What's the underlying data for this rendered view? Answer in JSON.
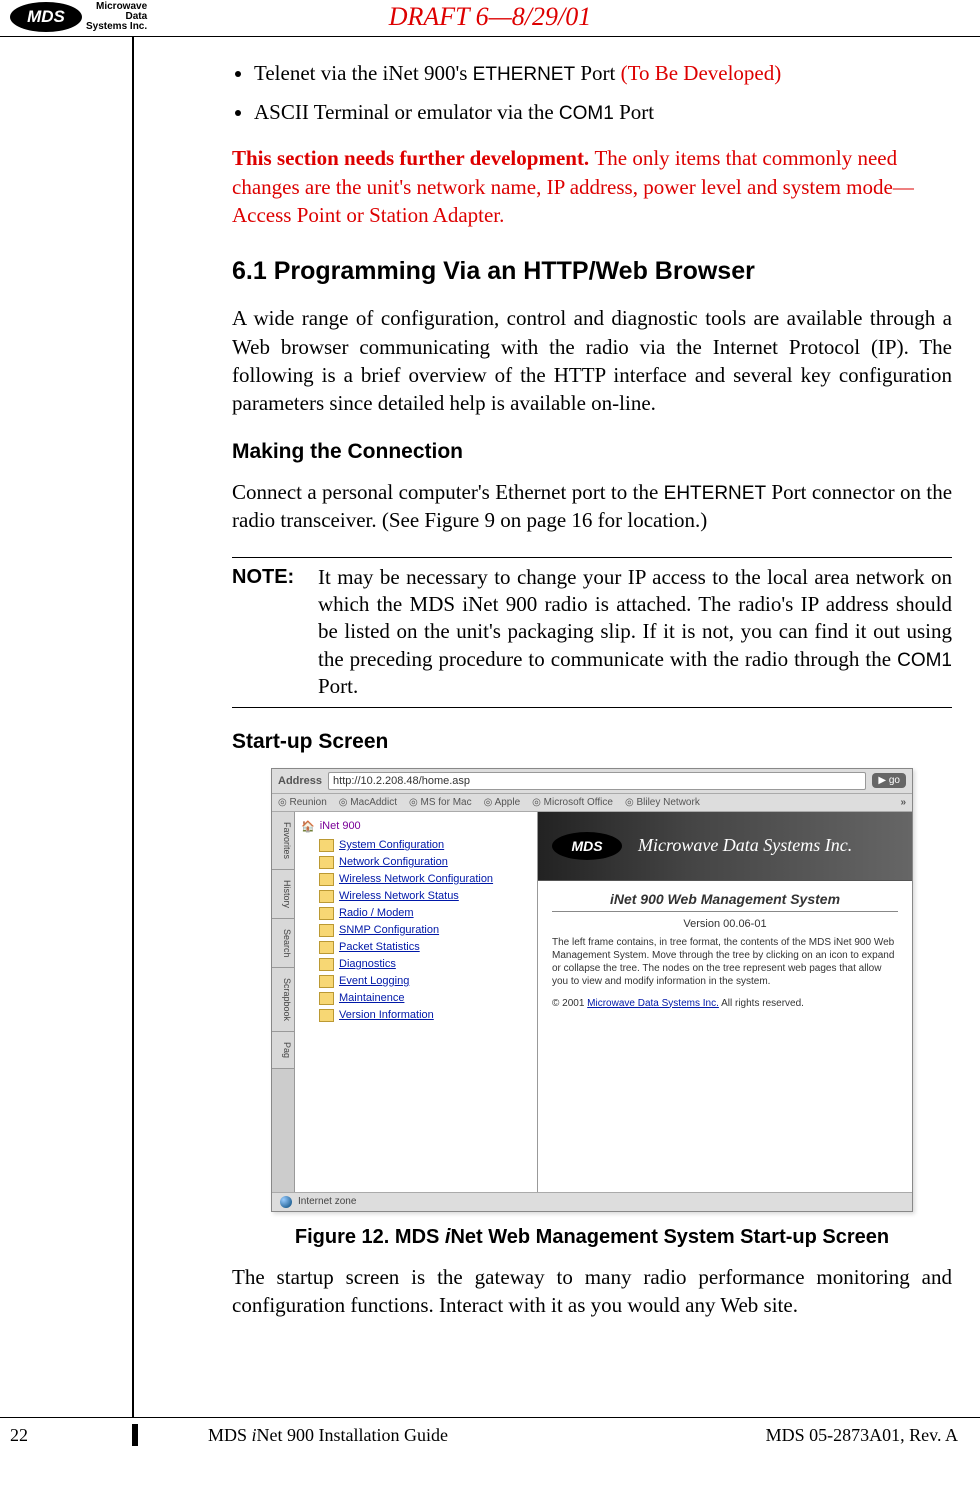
{
  "header": {
    "logo_short": "MDS",
    "logo_line1": "Microwave",
    "logo_line2": "Data",
    "logo_line3": "Systems Inc.",
    "draft": "DRAFT 6—8/29/01"
  },
  "bullets": {
    "b1_prefix": "Telenet via the iNet 900's ",
    "b1_code": "ETHERNET",
    "b1_suffix": " Port ",
    "b1_red": "(To Be Developed)",
    "b2_prefix": "ASCII Terminal or emulator via the ",
    "b2_code": "COM1",
    "b2_suffix": " Port"
  },
  "dev_note": {
    "bold": "This section needs further development. ",
    "rest": "The only items that commonly need changes are the unit's network name, IP address, power level and system mode—Access Point or Station Adapter."
  },
  "section_6_1": {
    "heading": "6.1   Programming Via an HTTP/Web Browser",
    "para": "A wide range of configuration, control and diagnostic tools are available through a Web browser communicating with the radio via the Internet Protocol (IP). The following is a brief overview of the HTTP interface and several key configuration parameters since detailed help is available on-line."
  },
  "making_conn": {
    "heading": "Making the Connection",
    "para_prefix": "Connect a personal computer's Ethernet port to the ",
    "para_code": "EHTERNET",
    "para_suffix": " Port connector on the radio transceiver. (See Figure 9 on page 16 for location.)"
  },
  "note": {
    "label": "NOTE:",
    "text_prefix": "It may be necessary to change your IP access to the local area network on which the MDS iNet 900 radio is attached. The radio's IP address should be listed on the unit's packaging slip. If it is not, you can find it out using the preceding procedure to communicate with the radio through the ",
    "text_code": "COM1",
    "text_suffix": " Port."
  },
  "startup_heading": "Start-up Screen",
  "screenshot": {
    "addr_label": "Address",
    "url": "http://10.2.208.48/home.asp",
    "go": "go",
    "bookmarks": [
      "Reunion",
      "MacAddict",
      "MS for Mac",
      "Apple",
      "Microsoft Office",
      "Bliley Network"
    ],
    "more": "»",
    "tabs": [
      "Favorites",
      "History",
      "Search",
      "Scrapbook",
      "Pag"
    ],
    "tree_root": "iNet 900",
    "tree_items": [
      "System Configuration",
      "Network Configuration",
      "Wireless Network Configuration",
      "Wireless Network Status",
      "Radio / Modem",
      "SNMP Configuration",
      "Packet Statistics",
      "Diagnostics",
      "Event Logging",
      "Maintainence",
      "Version Information"
    ],
    "banner_logo": "MDS",
    "banner_title": "Microwave Data Systems Inc.",
    "mgmt_title": "iNet 900 Web Management System",
    "mgmt_version": "Version 00.06-01",
    "mgmt_desc": "The left frame contains, in tree format, the contents of the MDS iNet 900 Web Management System. Move through the tree by clicking on an icon to expand or collapse the tree. The nodes on the tree represent web pages that allow you to view and modify information in the system.",
    "mgmt_copy_prefix": "© 2001 ",
    "mgmt_copy_link": "Microwave Data Systems Inc.",
    "mgmt_copy_suffix": " All rights reserved.",
    "status": "Internet zone"
  },
  "figure_caption_prefix": "Figure 12. MDS ",
  "figure_caption_italic": "i",
  "figure_caption_suffix": "Net Web Management System Start-up Screen",
  "closing_para": "The startup screen is the gateway to many radio performance monitoring and configuration functions. Interact with it as you would any Web site.",
  "footer": {
    "page": "22",
    "mid_prefix": "MDS ",
    "mid_italic": "i",
    "mid_suffix": "Net 900 Installation Guide",
    "right": "MDS 05-2873A01, Rev. A"
  }
}
